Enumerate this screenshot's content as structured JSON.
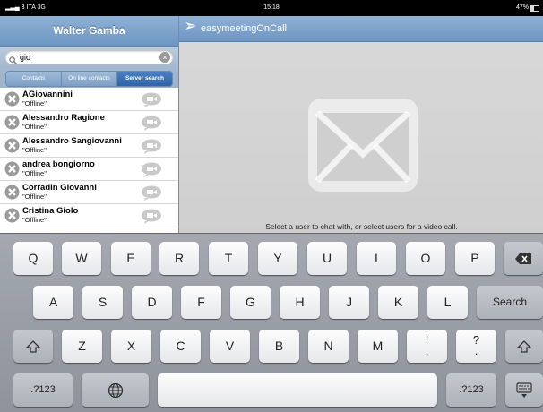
{
  "status_bar": {
    "carrier": "3 ITA",
    "network": "3G",
    "time": "15:18",
    "battery": "47%"
  },
  "left_panel": {
    "title": "Walter Gamba",
    "search": {
      "value": "gio",
      "placeholder": ""
    },
    "tabs": [
      {
        "label": "Contacts",
        "active": false
      },
      {
        "label": "On line contacts",
        "active": false
      },
      {
        "label": "Server search",
        "active": true
      }
    ],
    "contacts": [
      {
        "name": "AGiovannini",
        "status": "\"Offline\""
      },
      {
        "name": "Alessandro Ragione",
        "status": "\"Offline\""
      },
      {
        "name": "Alessandro Sangiovanni",
        "status": "\"Offline\""
      },
      {
        "name": "andrea bongiorno",
        "status": "\"Offline\""
      },
      {
        "name": "Corradin Giovanni",
        "status": "\"Offline\""
      },
      {
        "name": "Cristina Giolo",
        "status": "\"Offline\""
      }
    ]
  },
  "right_panel": {
    "app_title": "easymeetingOnCall",
    "hint": "Select a user to chat with, or select users for a video call."
  },
  "keyboard": {
    "row1": [
      "Q",
      "W",
      "E",
      "R",
      "T",
      "Y",
      "U",
      "I",
      "O",
      "P"
    ],
    "row2": [
      "A",
      "S",
      "D",
      "F",
      "G",
      "H",
      "J",
      "K",
      "L"
    ],
    "row3": [
      "Z",
      "X",
      "C",
      "V",
      "B",
      "N",
      "M"
    ],
    "punct1_top": "!",
    "punct1_bottom": ",",
    "punct2_top": "?",
    "punct2_bottom": ".",
    "search_label": "Search",
    "numbers_label": ".?123"
  },
  "colors": {
    "header_blue": "#7a9fca",
    "segment_active": "#3a6fb3"
  }
}
